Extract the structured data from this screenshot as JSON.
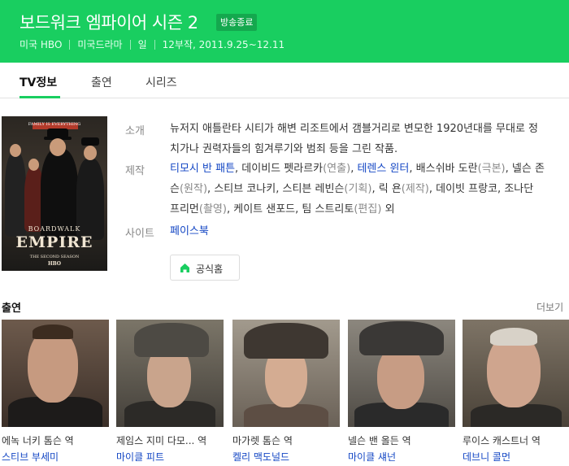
{
  "header": {
    "title": "보드워크 엠파이어 시즌 2",
    "badge": "방송종료",
    "meta": [
      "미국 HBO",
      "미국드라마",
      "일",
      "12부작, 2011.9.25~12.11"
    ],
    "bg_color": "#19ce60"
  },
  "tabs": [
    {
      "label": "TV정보",
      "active": true
    },
    {
      "label": "출연",
      "active": false
    },
    {
      "label": "시리즈",
      "active": false
    }
  ],
  "poster": {
    "top_text": "FAMILY IS EVERYTHING",
    "boardwalk": "BOARDWALK",
    "empire": "EMPIRE",
    "tagline": "THE SECOND SEASON",
    "hbo": "HBO"
  },
  "info": {
    "intro_label": "소개",
    "intro_text": "뉴저지 애틀란타 시티가 해변 리조트에서 갬블거리로 변모한 1920년대를 무대로 정치가나 권력자들의 힘겨루기와 범죄 등을 그린 작품.",
    "production_label": "제작",
    "credits": [
      {
        "name": "티모시 반 패튼",
        "role": "",
        "link": true
      },
      {
        "name": "데이비드 펫라르카",
        "role": "연출",
        "link": false
      },
      {
        "name": "테렌스 윈터",
        "role": "",
        "link": true
      },
      {
        "name": "배스쉬바 도란",
        "role": "극본",
        "link": false
      },
      {
        "name": "넬슨 존슨",
        "role": "원작",
        "link": false
      },
      {
        "name": "스티브 코나키",
        "role": "",
        "link": false
      },
      {
        "name": "스티븐 레빈슨",
        "role": "기획",
        "link": false
      },
      {
        "name": "릭 욘",
        "role": "제작",
        "link": false
      },
      {
        "name": "데이빗 프랑코",
        "role": "",
        "link": false
      },
      {
        "name": "조나단 프리먼",
        "role": "촬영",
        "link": false
      },
      {
        "name": "케이트 샌포드",
        "role": "",
        "link": false
      },
      {
        "name": "팀 스트리토",
        "role": "편집",
        "link": false
      }
    ],
    "credits_suffix": "외",
    "site_label": "사이트",
    "site_link": "페이스북",
    "home_button": "공식홈"
  },
  "cast_section": {
    "title": "출연",
    "more": "더보기",
    "members": [
      {
        "role": "에녹 너키 톰슨 역",
        "actor": "스티브 부세미"
      },
      {
        "role": "제임스 지미 다모... 역",
        "actor": "마이클 피트"
      },
      {
        "role": "마가렛 톰슨 역",
        "actor": "켈리 맥도널드"
      },
      {
        "role": "넬슨 밴 올든 역",
        "actor": "마이클 섀넌"
      },
      {
        "role": "루이스 캐스트너 역",
        "actor": "데브니 콜먼"
      }
    ]
  }
}
